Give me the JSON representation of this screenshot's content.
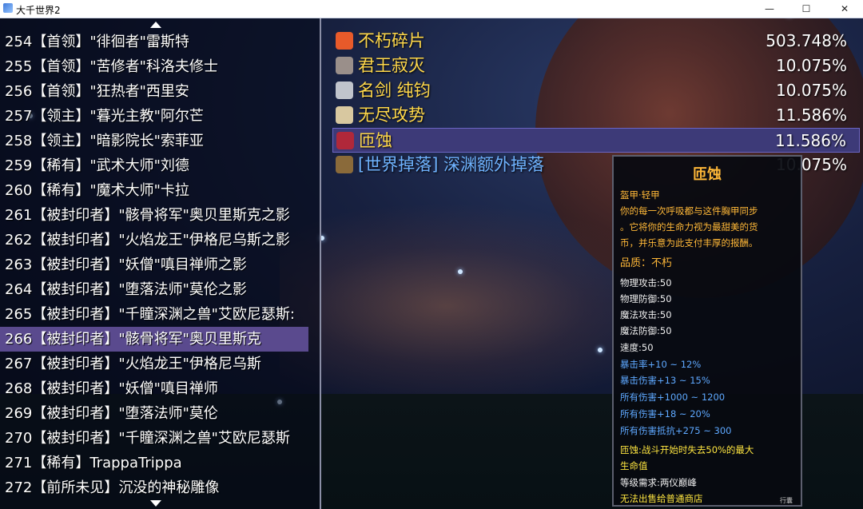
{
  "window": {
    "title": "大千世界2",
    "min_glyph": "—",
    "max_glyph": "☐",
    "close_glyph": "✕"
  },
  "list": {
    "selected_index": 12,
    "rows": [
      "254【首领】\"徘徊者\"雷斯特",
      "255【首领】\"苦修者\"科洛夫修士",
      "256【首领】\"狂热者\"西里安",
      "257【领主】\"暮光主教\"阿尔芒",
      "258【领主】\"暗影院长\"索菲亚",
      "259【稀有】\"武术大师\"刘德",
      "260【稀有】\"魔术大师\"卡拉",
      "261【被封印者】\"骸骨将军\"奥贝里斯克之影",
      "262【被封印者】\"火焰龙王\"伊格尼乌斯之影",
      "263【被封印者】\"妖僧\"嗔目禅师之影",
      "264【被封印者】\"堕落法师\"莫伦之影",
      "265【被封印者】\"千瞳深渊之兽\"艾欧尼瑟斯:",
      "266【被封印者】\"骸骨将军\"奥贝里斯克",
      "267【被封印者】\"火焰龙王\"伊格尼乌斯",
      "268【被封印者】\"妖僧\"嗔目禅师",
      "269【被封印者】\"堕落法师\"莫伦",
      "270【被封印者】\"千瞳深渊之兽\"艾欧尼瑟斯",
      "271【稀有】TrappaTrippa",
      "272【前所未见】沉没的神秘雕像"
    ]
  },
  "drops": [
    {
      "icon": "crystal-shard-icon",
      "name": "不朽碎片",
      "pct": "503.748%",
      "color": "#e85a2a"
    },
    {
      "icon": "mace-icon",
      "name": "君王寂灭",
      "pct": "10.075%",
      "color": "#9a8f8a"
    },
    {
      "icon": "sword-icon",
      "name": "名剑 纯钧",
      "pct": "10.075%",
      "color": "#c0c4cc"
    },
    {
      "icon": "amulet-icon",
      "name": "无尽攻势",
      "pct": "11.586%",
      "color": "#d8c8a0"
    },
    {
      "icon": "chest-armor-icon",
      "name": "匝蚀",
      "pct": "11.586%",
      "color": "#b0283a"
    },
    {
      "icon": "loot-bag-icon",
      "name": "[世界掉落] 深渊额外掉落",
      "pct": "10.075%",
      "color": "#8a6a3a"
    }
  ],
  "tooltip": {
    "title": "匝蚀",
    "type": "盔甲·轻甲",
    "desc1": "你的每一次呼吸都与这件胸甲同步",
    "desc2": "。它将你的生命力视为最甜美的货",
    "desc3": "币，并乐意为此支付丰厚的报酬。",
    "quality": "品质：不朽",
    "stats": [
      "物理攻击:50",
      "物理防御:50",
      "魔法攻击:50",
      "魔法防御:50",
      "速度:50"
    ],
    "bonus": [
      "暴击率+10 ~ 12%",
      "暴击伤害+13 ~ 15%",
      "所有伤害+1000 ~ 1200",
      "所有伤害+18 ~ 20%",
      "所有伤害抵抗+275 ~ 300"
    ],
    "effect1": "匝蚀:战斗开始时失去50%的最大",
    "effect2": "生命值",
    "requirement": "等级需求:两仪巅峰",
    "shop": "无法出售给普通商店",
    "footer": "行囊"
  }
}
